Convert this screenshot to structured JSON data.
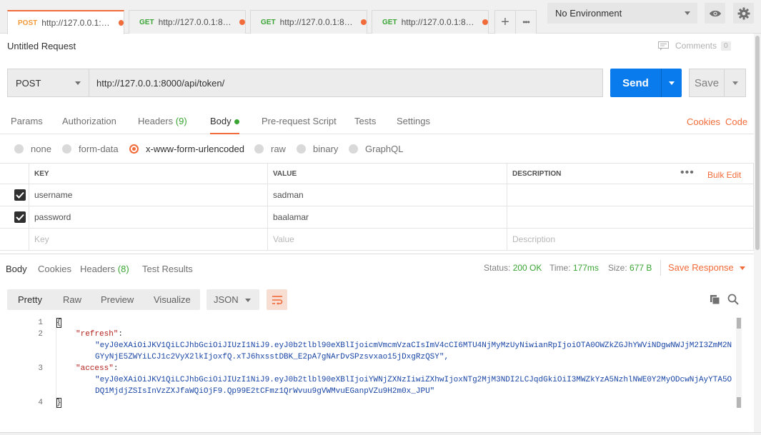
{
  "request_tabs": [
    {
      "method": "POST",
      "url": "http://127.0.0.1:800...",
      "active": true
    },
    {
      "method": "GET",
      "url": "http://127.0.0.1:8000",
      "active": false
    },
    {
      "method": "GET",
      "url": "http://127.0.0.1:8000...",
      "active": false
    },
    {
      "method": "GET",
      "url": "http://127.0.0.1:8000...",
      "active": false
    }
  ],
  "tab_actions": {
    "new_tab": "+",
    "more": "•••"
  },
  "environment": {
    "selected": "No Environment"
  },
  "request": {
    "title": "Untitled Request",
    "comments_label": "Comments",
    "comments_count": "0",
    "method": "POST",
    "url": "http://127.0.0.1:8000/api/token/",
    "send_label": "Send",
    "save_label": "Save"
  },
  "request_subtabs": {
    "params": "Params",
    "authorization": "Authorization",
    "headers": "Headers",
    "headers_count": "(9)",
    "body": "Body",
    "prerequest": "Pre-request Script",
    "tests": "Tests",
    "settings": "Settings",
    "cookies": "Cookies",
    "code": "Code"
  },
  "body_types": {
    "selected": "x-www-form-urlencoded",
    "options": [
      "none",
      "form-data",
      "x-www-form-urlencoded",
      "raw",
      "binary",
      "GraphQL"
    ]
  },
  "kv_table": {
    "headers": {
      "key": "KEY",
      "value": "VALUE",
      "description": "DESCRIPTION",
      "bulk_edit": "Bulk Edit"
    },
    "rows": [
      {
        "checked": true,
        "key": "username",
        "value": "sadman",
        "description": ""
      },
      {
        "checked": true,
        "key": "password",
        "value": "baalamar",
        "description": ""
      }
    ],
    "placeholders": {
      "key": "Key",
      "value": "Value",
      "description": "Description"
    }
  },
  "response": {
    "tabs": {
      "body": "Body",
      "cookies": "Cookies",
      "headers": "Headers",
      "headers_count": "(8)",
      "test_results": "Test Results"
    },
    "status_label": "Status:",
    "status_value": "200 OK",
    "time_label": "Time:",
    "time_value": "177ms",
    "size_label": "Size:",
    "size_value": "677 B",
    "save_response": "Save Response",
    "views": {
      "pretty": "Pretty",
      "raw": "Raw",
      "preview": "Preview",
      "visualize": "Visualize"
    },
    "language": "JSON",
    "line_numbers": [
      "1",
      "2",
      "3",
      "4"
    ],
    "code": {
      "open_brace": "{",
      "refresh_key": "\"refresh\"",
      "refresh_value_1": "\"eyJ0eXAiOiJKV1QiLCJhbGciOiJIUzI1NiJ9.eyJ0b2tlbl90eXBlIjoicmVmcmVzaCIsImV4cCI6MTU4NjMyMzUyNiwianRpIjoiOTA0OWZkZGJhYWViNDgwNWJjM2I3ZmM2N",
      "refresh_value_2": "GYyNjE5ZWYiLCJ1c2VyX2lkIjoxfQ.xTJ6hxsstDBK_E2pA7gNArDvSPzsvxao15jDxgRzQSY\",",
      "access_key": "\"access\"",
      "access_value_1": "\"eyJ0eXAiOiJKV1QiLCJhbGciOiJIUzI1NiJ9.eyJ0b2tlbl90eXBlIjoiYWNjZXNzIiwiZXhwIjoxNTg2MjM3NDI2LCJqdGkiOiI3MWZkYzA5NzhlNWE0Y2MyODcwNjAyYTA5O",
      "access_value_2": "DQ1MjdjZSIsInVzZXJfaWQiOjF9.Qp99E2tCFmz1QrWvuu9gVWMvuEGanpVZu9H2m0x_JPU\"",
      "close_brace": "}"
    }
  },
  "colors": {
    "accent": "#f26b3a",
    "send": "#097bed",
    "success": "#3aa534"
  }
}
